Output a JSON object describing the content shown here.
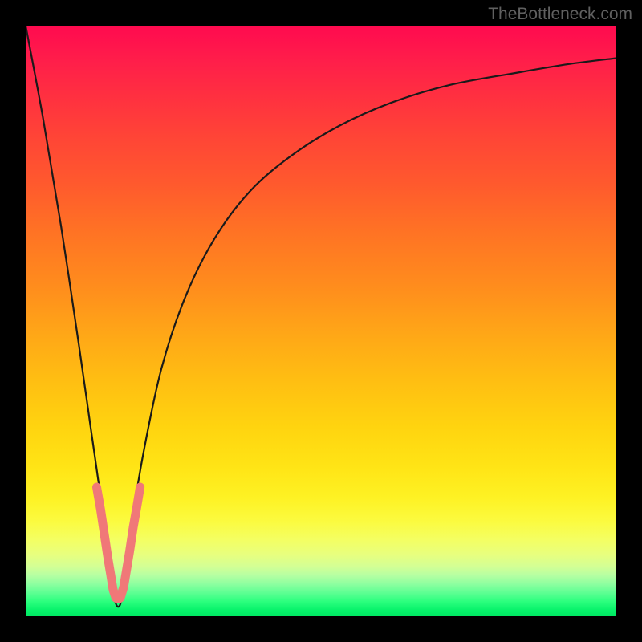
{
  "watermark": "TheBottleneck.com",
  "colors": {
    "frame": "#000000",
    "curve_stroke": "#1a1a1a",
    "marker_fill": "#f07878",
    "gradient_top": "#ff0a4f",
    "gradient_bottom": "#00e862"
  },
  "chart_data": {
    "type": "line",
    "title": "",
    "xlabel": "",
    "ylabel": "",
    "x_range": [
      0,
      100
    ],
    "y_range": [
      0,
      100
    ],
    "note": "Values estimated from pixel positions; x maps 0→100 left-to-right, y is bottleneck percent (0 at bottom/green, 100 at top/red). Minimum near x≈15.",
    "series": [
      {
        "name": "bottleneck-curve",
        "x": [
          0,
          3,
          6,
          9,
          11,
          13,
          14,
          15,
          16,
          17,
          18,
          20,
          23,
          27,
          32,
          38,
          45,
          53,
          62,
          72,
          83,
          92,
          100
        ],
        "y": [
          100,
          84,
          66,
          46,
          32,
          18,
          10,
          3,
          2,
          8,
          16,
          28,
          42,
          54,
          64,
          72,
          78,
          83,
          87,
          90,
          92,
          93.5,
          94.5
        ]
      }
    ],
    "markers": {
      "name": "highlight-segments",
      "points": [
        {
          "x": 12.0,
          "y": 22
        },
        {
          "x": 12.7,
          "y": 18
        },
        {
          "x": 13.3,
          "y": 14
        },
        {
          "x": 13.9,
          "y": 10
        },
        {
          "x": 14.4,
          "y": 7
        },
        {
          "x": 14.8,
          "y": 4.5
        },
        {
          "x": 15.3,
          "y": 3.0
        },
        {
          "x": 16.0,
          "y": 3.0
        },
        {
          "x": 16.6,
          "y": 5.0
        },
        {
          "x": 17.6,
          "y": 11
        },
        {
          "x": 18.2,
          "y": 15
        },
        {
          "x": 18.9,
          "y": 19
        },
        {
          "x": 19.4,
          "y": 22
        }
      ]
    }
  }
}
